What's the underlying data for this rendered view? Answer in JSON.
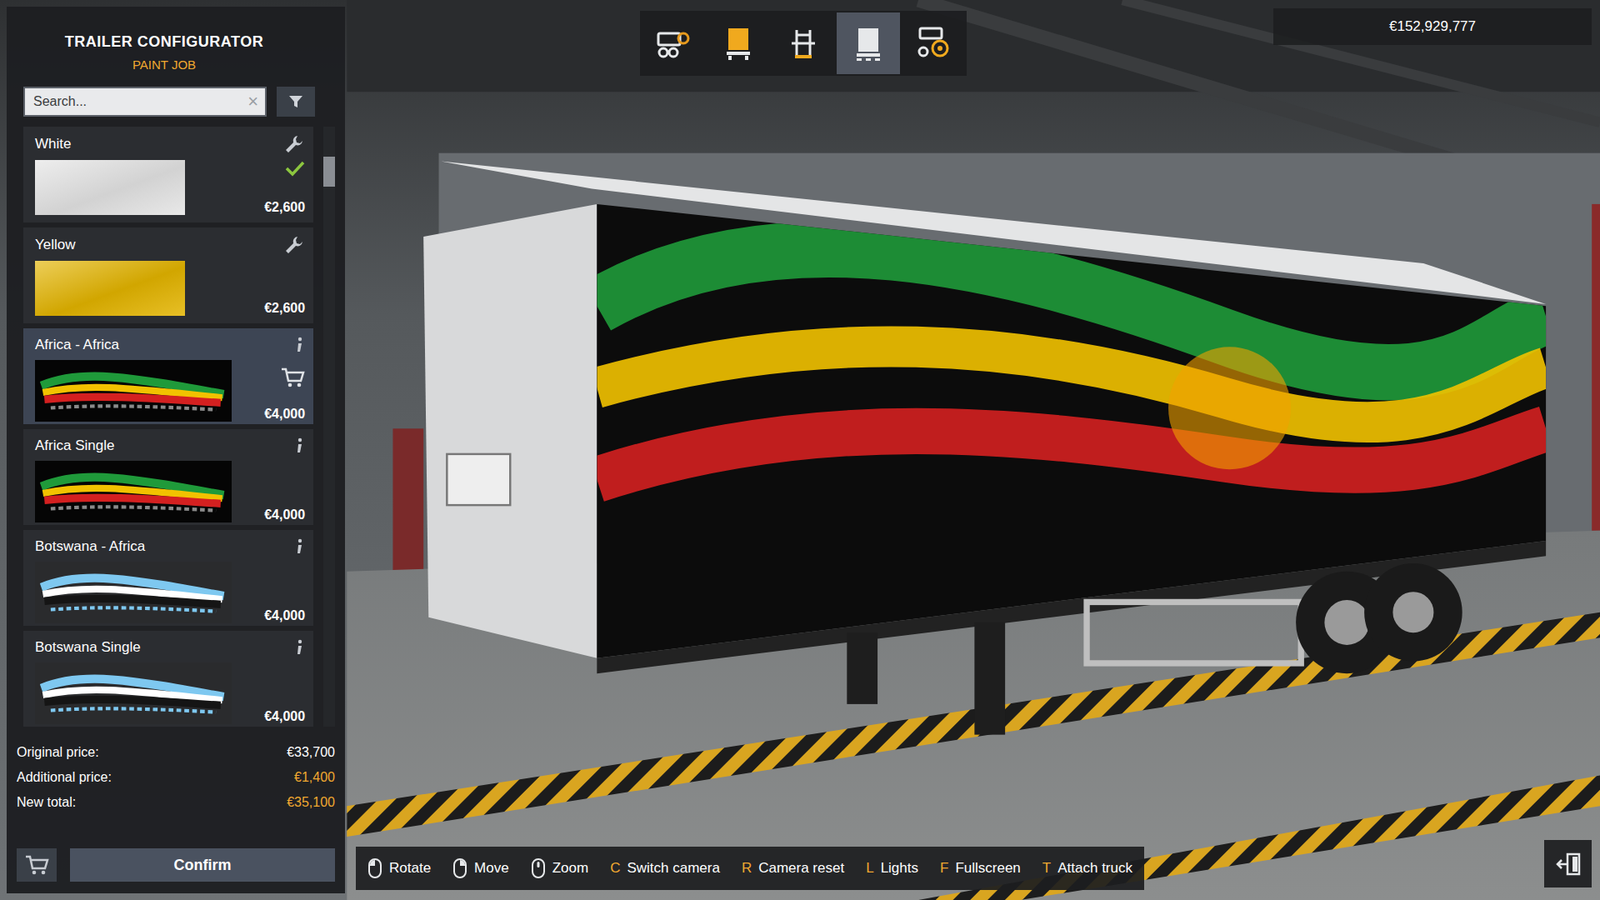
{
  "panel": {
    "title": "TRAILER CONFIGURATOR",
    "subtitle": "PAINT JOB"
  },
  "search": {
    "placeholder": "Search...",
    "clear": "×"
  },
  "paint_jobs": [
    {
      "name": "White",
      "price": "€2,600",
      "kind": "solid",
      "color": "#e4e4e4",
      "applied": true,
      "selected": false,
      "in_cart": false
    },
    {
      "name": "Yellow",
      "price": "€2,600",
      "kind": "solid",
      "color": "#e3b400",
      "applied": false,
      "selected": false,
      "in_cart": false
    },
    {
      "name": "Africa - Africa",
      "price": "€4,000",
      "kind": "livery",
      "colors": [
        "#050505",
        "#1f9a3a",
        "#f2c200",
        "#d42020",
        "#8a8a8a"
      ],
      "applied": false,
      "selected": true,
      "in_cart": true
    },
    {
      "name": "Africa Single",
      "price": "€4,000",
      "kind": "livery",
      "colors": [
        "#050505",
        "#1f9a3a",
        "#f2c200",
        "#d42020",
        "#8a8a8a"
      ],
      "applied": false,
      "selected": false,
      "in_cart": false
    },
    {
      "name": "Botswana - Africa",
      "price": "€4,000",
      "kind": "livery",
      "colors": [
        "#2a2b2d",
        "#7ec8f0",
        "#ffffff",
        "#151515",
        "#7ec8f0"
      ],
      "applied": false,
      "selected": false,
      "in_cart": false
    },
    {
      "name": "Botswana Single",
      "price": "€4,000",
      "kind": "livery",
      "colors": [
        "#2a2b2d",
        "#7ec8f0",
        "#ffffff",
        "#151515",
        "#7ec8f0"
      ],
      "applied": false,
      "selected": false,
      "in_cart": false
    }
  ],
  "scrollbar": {
    "position": 0.05,
    "size": 0.05
  },
  "totals": [
    {
      "label": "Original price:",
      "value": "€33,700",
      "highlight": false
    },
    {
      "label": "Additional price:",
      "value": "€1,400",
      "highlight": true
    },
    {
      "label": "New total:",
      "value": "€35,100",
      "highlight": true
    }
  ],
  "confirm": "Confirm",
  "toolbar": [
    {
      "selected": false
    },
    {
      "selected": false
    },
    {
      "selected": false
    },
    {
      "selected": true
    },
    {
      "selected": false
    }
  ],
  "money": "€152,929,777",
  "hints": [
    {
      "kind": "mouseleft",
      "label": "Rotate"
    },
    {
      "kind": "mouseright",
      "label": "Move"
    },
    {
      "kind": "mousewheel",
      "label": "Zoom"
    },
    {
      "kind": "key",
      "key": "C",
      "label": "Switch camera"
    },
    {
      "kind": "key",
      "key": "R",
      "label": "Camera reset"
    },
    {
      "kind": "key",
      "key": "L",
      "label": "Lights"
    },
    {
      "kind": "key",
      "key": "F",
      "label": "Fullscreen"
    },
    {
      "kind": "key",
      "key": "T",
      "label": "Attach truck"
    }
  ]
}
